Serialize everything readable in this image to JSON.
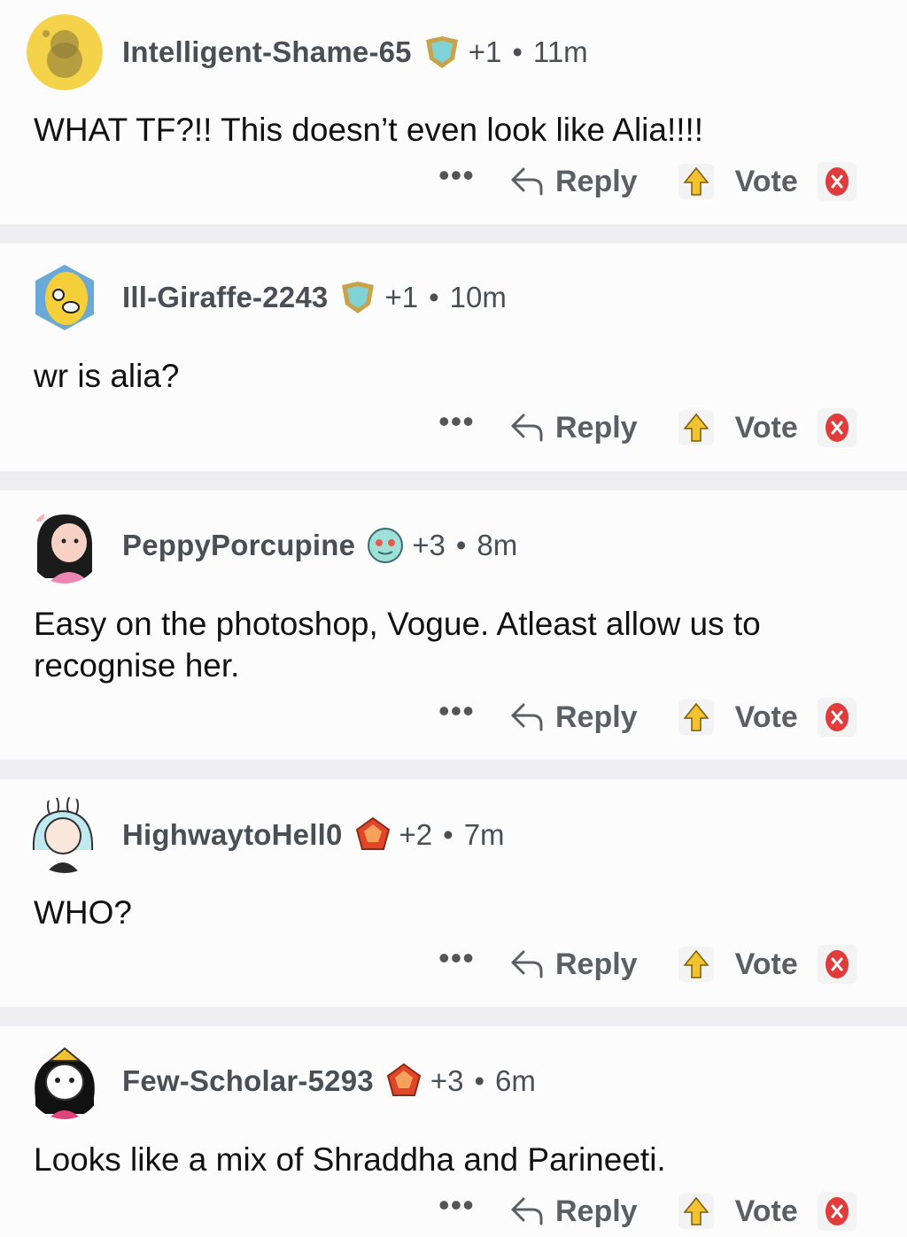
{
  "comments": [
    {
      "author": "Intelligent-Shame-65",
      "award": "+1",
      "separator": "•",
      "age": "11m",
      "text": "WHAT TF?!! This doesn’t even look like Alia!!!!",
      "reply_label": "Reply",
      "vote_label": "Vote",
      "more_label": "•••",
      "avatar": "yellow-snoo-avatar",
      "flair": "gold-shield-flair"
    },
    {
      "author": "Ill-Giraffe-2243",
      "award": "+1",
      "separator": "•",
      "age": "10m",
      "text": "wr is alia?",
      "reply_label": "Reply",
      "vote_label": "Vote",
      "more_label": "•••",
      "avatar": "banana-avatar",
      "flair": "gold-shield-flair"
    },
    {
      "author": "PeppyPorcupine",
      "award": "+3",
      "separator": "•",
      "age": "8m",
      "text": "Easy on the photoshop, Vogue. Atleast allow us to recognise her.",
      "reply_label": "Reply",
      "vote_label": "Vote",
      "more_label": "•••",
      "avatar": "girl-avatar",
      "flair": "alien-flair"
    },
    {
      "author": "HighwaytoHell0",
      "award": "+2",
      "separator": "•",
      "age": "7m",
      "text": "WHO?",
      "reply_label": "Reply",
      "vote_label": "Vote",
      "more_label": "•••",
      "avatar": "bunny-girl-avatar",
      "flair": "ruby-gem-flair"
    },
    {
      "author": "Few-Scholar-5293",
      "award": "+3",
      "separator": "•",
      "age": "6m",
      "text": "Looks like a mix of Shraddha and Parineeti.",
      "reply_label": "Reply",
      "vote_label": "Vote",
      "more_label": "•••",
      "avatar": "snoo-crown-avatar",
      "flair": "ruby-gem-flair"
    }
  ],
  "colors": {
    "meta": "#4a4f55",
    "downvote": "#e23b3b",
    "upvote_fill": "#f2c230",
    "separator": "#eeeef0"
  }
}
